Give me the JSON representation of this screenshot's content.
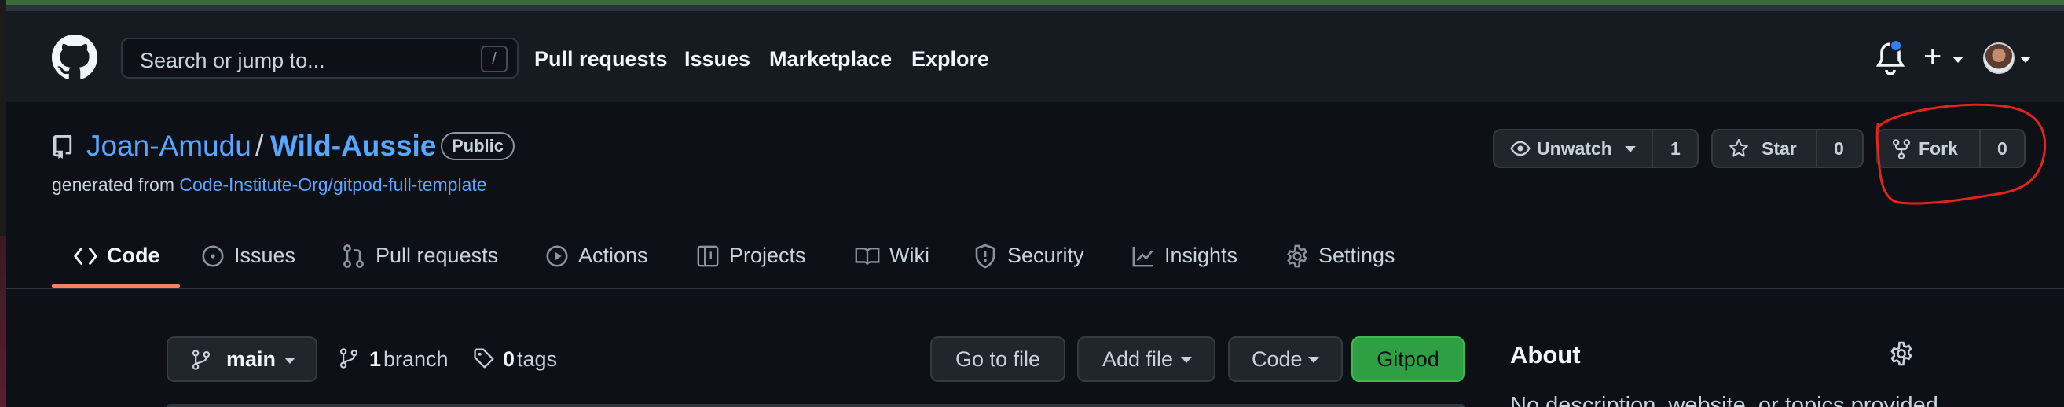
{
  "header": {
    "search_placeholder": "Search or jump to...",
    "search_shortcut": "/",
    "nav": [
      "Pull requests",
      "Issues",
      "Marketplace",
      "Explore"
    ],
    "plus_symbol": "+"
  },
  "repo": {
    "owner": "Joan-Amudu",
    "separator": "/",
    "name": "Wild-Aussie",
    "visibility": "Public",
    "generated_prefix": "generated from",
    "template_link": "Code-Institute-Org/gitpod-full-template"
  },
  "actions": {
    "unwatch_label": "Unwatch",
    "unwatch_count": "1",
    "star_label": "Star",
    "star_count": "0",
    "fork_label": "Fork",
    "fork_count": "0"
  },
  "tabs": [
    {
      "label": "Code",
      "icon": "code-icon",
      "active": true
    },
    {
      "label": "Issues",
      "icon": "issue-icon"
    },
    {
      "label": "Pull requests",
      "icon": "pull-request-icon"
    },
    {
      "label": "Actions",
      "icon": "play-icon"
    },
    {
      "label": "Projects",
      "icon": "table-icon"
    },
    {
      "label": "Wiki",
      "icon": "book-icon"
    },
    {
      "label": "Security",
      "icon": "shield-icon"
    },
    {
      "label": "Insights",
      "icon": "graph-icon"
    },
    {
      "label": "Settings",
      "icon": "gear-icon"
    }
  ],
  "toolbar": {
    "branch": "main",
    "branch_count": "1",
    "branch_word": "branch",
    "tag_count": "0",
    "tag_word": "tags",
    "go_to_file": "Go to file",
    "add_file": "Add file",
    "code": "Code",
    "gitpod": "Gitpod"
  },
  "about": {
    "title": "About",
    "description_partial": "No description, website, or topics provided."
  },
  "colors": {
    "accent_link": "#58a6ff",
    "active_tab_underline": "#f78166",
    "gitpod_green": "#2ea043",
    "annotation_red": "#e5221b",
    "notification_dot": "#2f81f7"
  }
}
